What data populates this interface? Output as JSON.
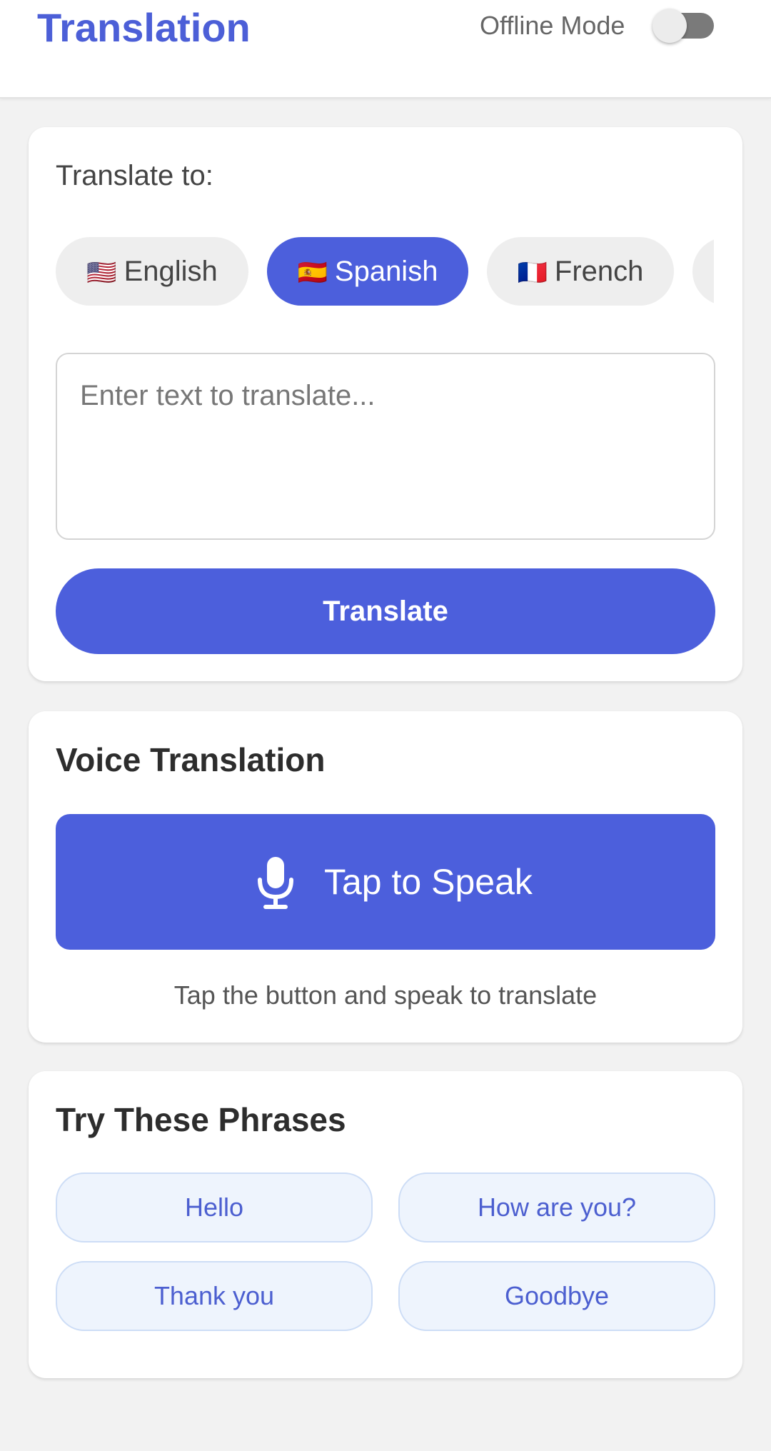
{
  "header": {
    "title": "Translation",
    "offline_label": "Offline Mode",
    "offline_enabled": false
  },
  "translate": {
    "label": "Translate to:",
    "languages": [
      {
        "flag": "🇺🇸",
        "name": "English",
        "selected": false
      },
      {
        "flag": "🇪🇸",
        "name": "Spanish",
        "selected": true
      },
      {
        "flag": "🇫🇷",
        "name": "French",
        "selected": false
      }
    ],
    "input_placeholder": "Enter text to translate...",
    "button_label": "Translate"
  },
  "voice": {
    "title": "Voice Translation",
    "button_label": "Tap to Speak",
    "button_icon": "microphone-icon",
    "hint": "Tap the button and speak to translate"
  },
  "phrases": {
    "title": "Try These Phrases",
    "items": [
      "Hello",
      "How are you?",
      "Thank you",
      "Goodbye"
    ]
  },
  "colors": {
    "accent": "#4c5fdc",
    "background": "#f2f2f2",
    "phrase_bg": "#eef4fd"
  }
}
